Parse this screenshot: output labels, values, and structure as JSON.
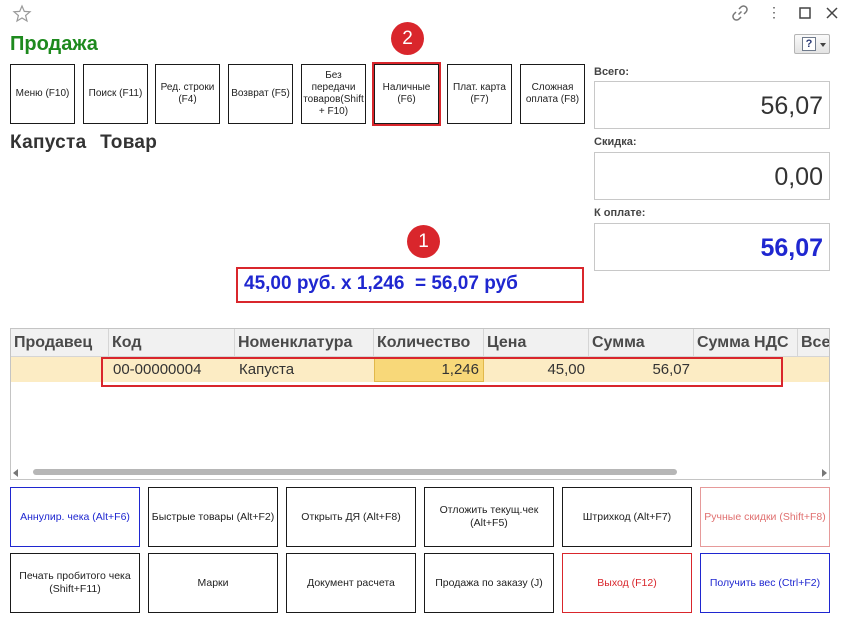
{
  "window": {
    "title": "Продажа"
  },
  "function_buttons": [
    {
      "label": "Меню (F10)"
    },
    {
      "label": "Поиск (F11)"
    },
    {
      "label": "Ред. строки\n(F4)"
    },
    {
      "label": "Возврат (F5)"
    },
    {
      "label": "Без\nпередачи\nтоваров(Shift\n+ F10)"
    },
    {
      "label": "Наличные\n(F6)"
    },
    {
      "label": "Плат. карта\n(F7)"
    },
    {
      "label": "Сложная\nоплата (F8)"
    }
  ],
  "annotations": {
    "badge_1": "1",
    "badge_2": "2"
  },
  "product": {
    "name": "Капуста Товар",
    "calc": "45,00 руб. x 1,246  = 56,07 руб"
  },
  "totals": {
    "total_label": "Всего:",
    "total_value": "56,07",
    "discount_label": "Скидка:",
    "discount_value": "0,00",
    "to_pay_label": "К оплате:",
    "to_pay_value": "56,07"
  },
  "table": {
    "columns": [
      "Продавец",
      "Код",
      "Номенклатура",
      "Количество",
      "Цена",
      "Сумма",
      "Сумма НДС",
      "Все"
    ],
    "rows": [
      {
        "seller": "",
        "code": "00-00000004",
        "item": "Капуста",
        "qty": "1,246",
        "price": "45,00",
        "sum": "56,07",
        "vat": "",
        "all": ""
      }
    ]
  },
  "bottom_buttons": {
    "row1": [
      {
        "label": "Аннулир. чека (Alt+F6)"
      },
      {
        "label": "Быстрые товары (Alt+F2)"
      },
      {
        "label": "Открыть ДЯ (Alt+F8)"
      },
      {
        "label": "Отложить текущ.чек\n(Alt+F5)"
      },
      {
        "label": "Штрихкод (Alt+F7)"
      },
      {
        "label": "Ручные скидки (Shift+F8)"
      }
    ],
    "row2": [
      {
        "label": "Печать пробитого чека\n(Shift+F11)"
      },
      {
        "label": "Марки"
      },
      {
        "label": "Документ расчета"
      },
      {
        "label": "Продажа по заказу (J)"
      },
      {
        "label": "Выход (F12)"
      },
      {
        "label": "Получить вес (Ctrl+F2)"
      }
    ]
  },
  "colors": {
    "title_green": "#1e8a1e",
    "accent_blue": "#1f27d0",
    "highlight_red": "#d9262c",
    "row_highlight": "#fcecc4"
  }
}
